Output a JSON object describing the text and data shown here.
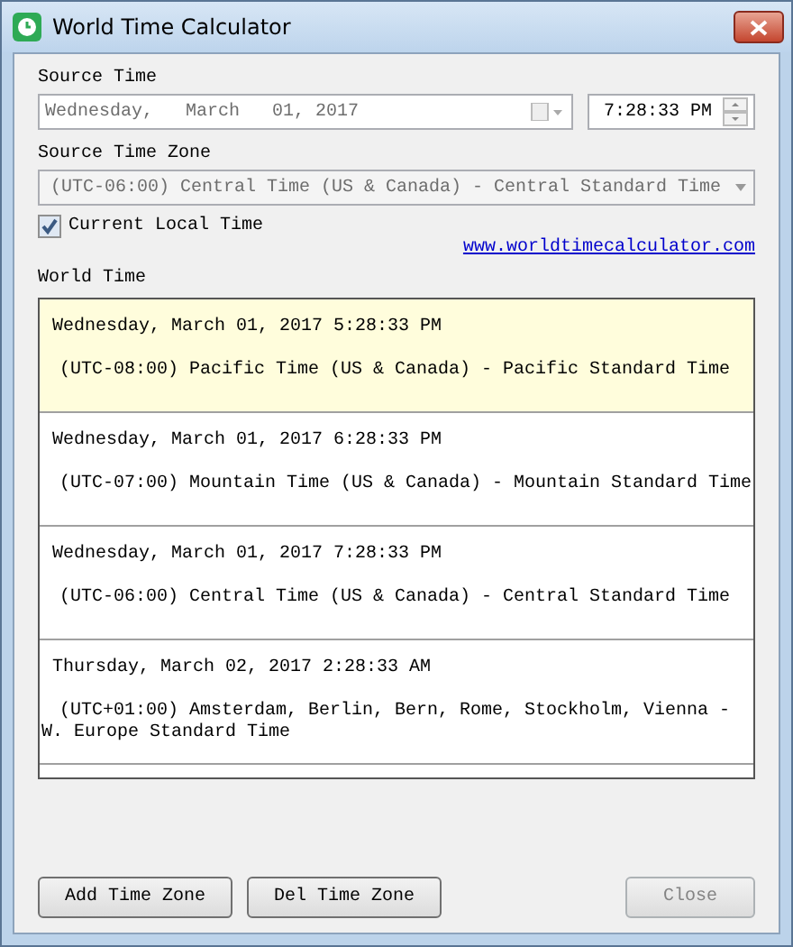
{
  "window": {
    "title": "World Time Calculator"
  },
  "source_time": {
    "label": "Source Time",
    "date": "Wednesday,   March   01, 2017",
    "time": "7:28:33 PM"
  },
  "source_time_zone": {
    "label": "Source Time Zone",
    "value": "(UTC-06:00) Central Time (US & Canada) - Central Standard Time",
    "disabled": true
  },
  "current_local_time": {
    "label": "Current Local Time",
    "checked": true
  },
  "link": "www.worldtimecalculator.com",
  "world_time": {
    "label": "World Time",
    "rows": [
      {
        "datetime": "Wednesday, March 01, 2017 5:28:33 PM",
        "zone": "(UTC-08:00) Pacific Time (US & Canada) - Pacific Standard Time",
        "selected": true
      },
      {
        "datetime": "Wednesday, March 01, 2017 6:28:33 PM",
        "zone": "(UTC-07:00) Mountain Time (US & Canada) - Mountain Standard Time",
        "selected": false
      },
      {
        "datetime": "Wednesday, March 01, 2017 7:28:33 PM",
        "zone": "(UTC-06:00) Central Time (US & Canada) - Central Standard Time",
        "selected": false
      },
      {
        "datetime": "Thursday, March 02, 2017 2:28:33 AM",
        "zone": "(UTC+01:00) Amsterdam, Berlin, Bern, Rome, Stockholm, Vienna - W. Europe Standard Time",
        "selected": false
      }
    ]
  },
  "buttons": [
    {
      "label": "Add Time Zone",
      "disabled": false
    },
    {
      "label": "Del Time Zone",
      "disabled": false
    },
    {
      "label": "Close",
      "disabled": true
    }
  ]
}
